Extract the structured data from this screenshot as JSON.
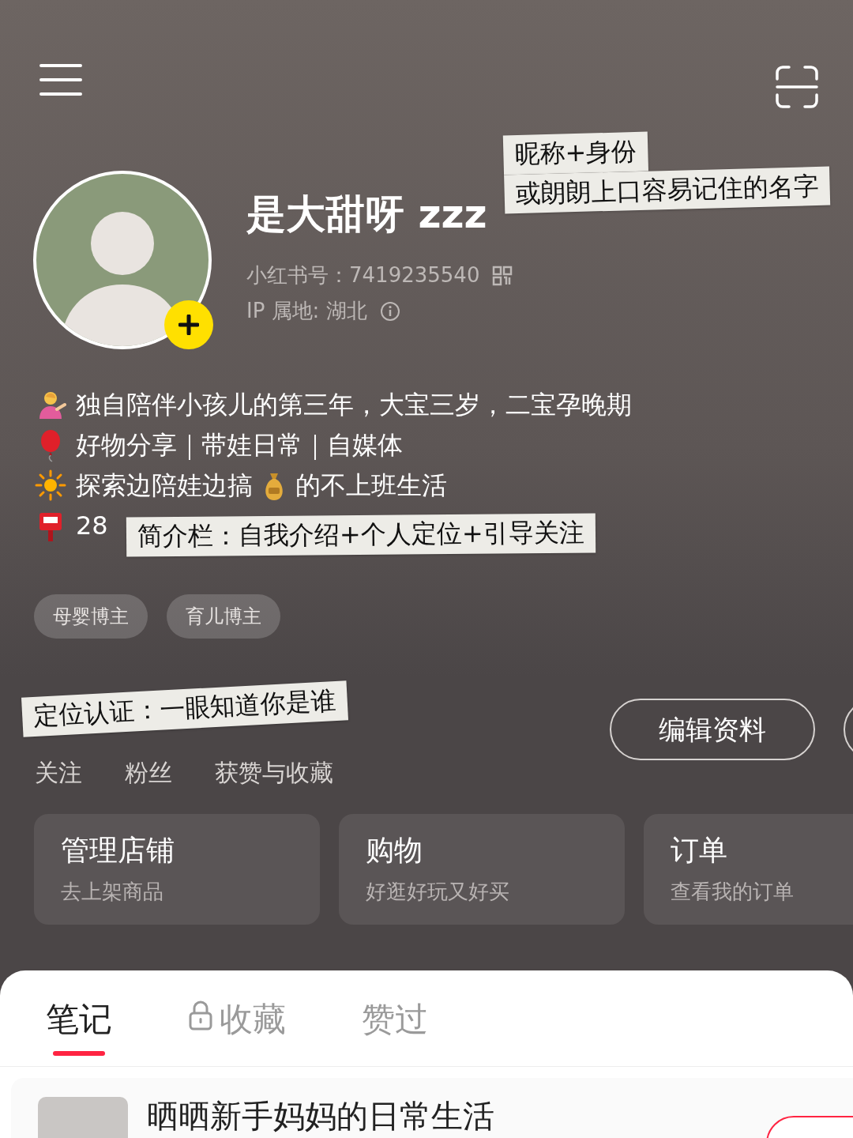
{
  "profile": {
    "name": "是大甜呀 zzz",
    "id_line": "小红书号：7419235540",
    "ip_line": "IP 属地: 湖北"
  },
  "bio": [
    {
      "kind": "person",
      "parts": [
        "独自陪伴小孩儿的第三年，大宝三岁，二宝孕晚期"
      ]
    },
    {
      "kind": "balloon",
      "parts": [
        "好物分享｜带娃日常｜自媒体"
      ]
    },
    {
      "kind": "sun",
      "parts": [
        "探索边陪娃边搞",
        "的不上班生活"
      ]
    },
    {
      "kind": "mailbox",
      "parts": [
        "28"
      ]
    }
  ],
  "tags": [
    "母婴博主",
    "育儿博主"
  ],
  "stats": [
    {
      "label": "关注"
    },
    {
      "label": "粉丝"
    },
    {
      "label": "获赞与收藏"
    }
  ],
  "edit_button": "编辑资料",
  "cards": [
    {
      "title": "管理店铺",
      "subtitle": "去上架商品"
    },
    {
      "title": "购物",
      "subtitle": "好逛好玩又好买"
    },
    {
      "title": "订单",
      "subtitle": "查看我的订单"
    }
  ],
  "tabs": [
    {
      "label": "笔记",
      "selected": true,
      "locked": false
    },
    {
      "label": "收藏",
      "selected": false,
      "locked": true
    },
    {
      "label": "赞过",
      "selected": false,
      "locked": false
    }
  ],
  "note": {
    "title": "晒晒新手妈妈的日常生活"
  },
  "stickers": [
    {
      "lines": [
        "昵称+身份",
        "或朗朗上口容易记住的名字"
      ]
    },
    {
      "lines": [
        "简介栏：自我介绍+个人定位+引导关注"
      ]
    },
    {
      "lines": [
        "定位认证：一眼知道你是谁"
      ]
    }
  ]
}
